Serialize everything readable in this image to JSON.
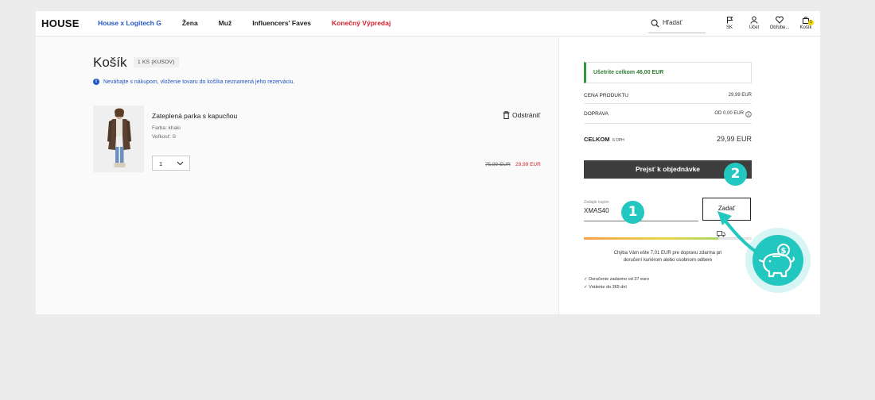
{
  "header": {
    "logo": "HOUSE",
    "nav": [
      {
        "label": "House x Logitech G",
        "style": "blue"
      },
      {
        "label": "Žena",
        "style": "normal"
      },
      {
        "label": "Muž",
        "style": "normal"
      },
      {
        "label": "Influencers' Faves",
        "style": "normal"
      },
      {
        "label": "Konečný Výpredaj",
        "style": "red"
      }
    ],
    "search_label": "Hľadať",
    "icons": [
      {
        "label": "SK",
        "icon": "flag-icon"
      },
      {
        "label": "Účet",
        "icon": "user-icon"
      },
      {
        "label": "Obľúbe...",
        "icon": "heart-icon"
      },
      {
        "label": "Košík",
        "icon": "bag-icon",
        "badge": "1"
      }
    ]
  },
  "cart": {
    "title": "Košík",
    "count_label": "1 KS (KUSOV)",
    "info": "Neváhajte s nákupom, vloženie tovaru do košíka neznamená jeho rezerváciu.",
    "item": {
      "name": "Zateplená parka s kapucňou",
      "color": "Farba: khaki",
      "size": "Veľkosť: S",
      "quantity": "1",
      "remove_label": "Odstrániť",
      "old_price": "75,99 EUR",
      "new_price": "29,99 EUR"
    }
  },
  "summary": {
    "savings": "Ušetrite celkom 46,00 EUR",
    "products_label": "CENA PRODUKTU",
    "products_value": "29,99 EUR",
    "shipping_label": "DOPRAVA",
    "shipping_value": "OD 0,00 EUR",
    "total_label": "CELKOM",
    "total_vat": "S DPH",
    "total_value": "29,99 EUR",
    "checkout_label": "Prejsť k objednávke",
    "coupon_label": "Zadajte kupón",
    "coupon_value": "XMAS40",
    "apply_label": "Zadať",
    "shipping_progress": 0.8,
    "shipping_note_1": "Chýba Vám ešte 7,01 EUR pre dopravu zdarma pri",
    "shipping_note_2": "doručení kuriérom alebo osobnom odbere",
    "bullets": [
      "Doručenie zadarmo od 37 euro",
      "Vrátenie do 365 dní"
    ]
  },
  "annotations": {
    "step1": "1",
    "step2": "2"
  },
  "colors": {
    "accent_teal": "#22c7c0",
    "nav_blue": "#2457c5",
    "sale_red": "#d41f2c",
    "savings_green": "#2f9a3f",
    "button_dark": "#3e3e3e"
  }
}
